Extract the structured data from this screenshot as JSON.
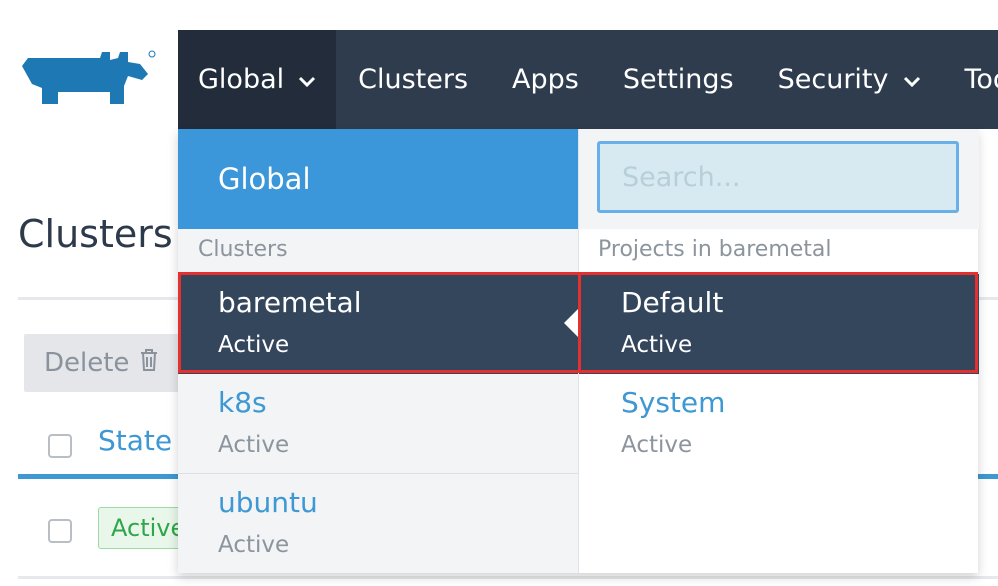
{
  "nav": {
    "global_label": "Global",
    "items": [
      "Clusters",
      "Apps",
      "Settings",
      "Security",
      "Tools"
    ]
  },
  "page": {
    "title": "Clusters",
    "delete_label": "Delete",
    "state_header": "State",
    "row_state": "Active"
  },
  "dropdown": {
    "global_label": "Global",
    "clusters_label": "Clusters",
    "clusters": [
      {
        "name": "baremetal",
        "status": "Active",
        "selected": true
      },
      {
        "name": "k8s",
        "status": "Active",
        "selected": false
      },
      {
        "name": "ubuntu",
        "status": "Active",
        "selected": false
      }
    ],
    "search_placeholder": "Search...",
    "projects_label": "Projects in baremetal",
    "projects": [
      {
        "name": "Default",
        "status": "Active",
        "selected": true
      },
      {
        "name": "System",
        "status": "Active",
        "selected": false
      }
    ]
  },
  "colors": {
    "nav_bg": "#2f3c4e",
    "accent": "#3b97d9",
    "selected_bg": "#34465c",
    "highlight": "#e5302f"
  },
  "icons": {
    "logo": "rancher-logo",
    "chevron": "chevron-down-icon",
    "delete": "trash-icon"
  }
}
